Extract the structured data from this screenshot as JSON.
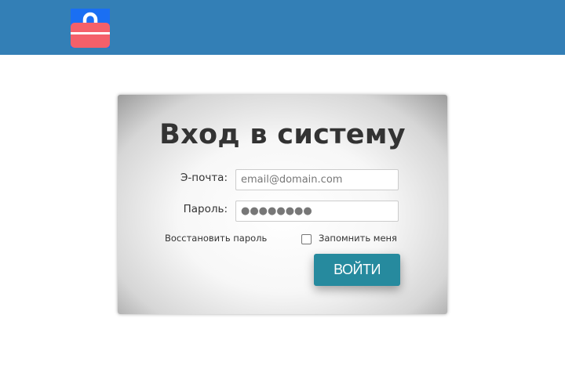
{
  "header": {
    "logo_icon": "briefcase-lock-icon",
    "colors": {
      "bar": "#337fb6",
      "logo_bg": "#1a6ff3",
      "logo_case": "#f4606a"
    }
  },
  "login": {
    "title": "Вход в систему",
    "email_label": "Э-почта:",
    "email_placeholder": "email@domain.com",
    "email_value": "",
    "password_label": "Пароль:",
    "password_value": "●●●●●●●●",
    "recover_link": "Восстановить пароль",
    "remember_label": "Запомнить меня",
    "remember_checked": false,
    "submit_label": "ВОЙТИ",
    "colors": {
      "submit": "#268a9e",
      "title": "#333333"
    }
  }
}
